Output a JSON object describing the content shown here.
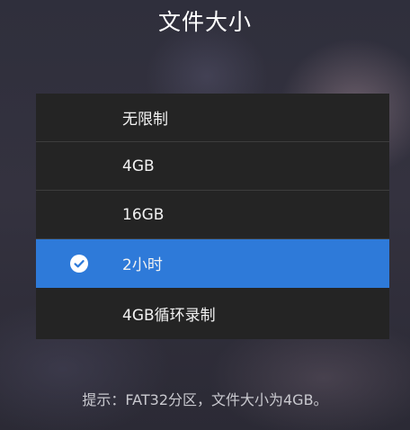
{
  "dialog": {
    "title": "文件大小",
    "options": [
      {
        "label": "无限制",
        "selected": false
      },
      {
        "label": "4GB",
        "selected": false
      },
      {
        "label": "16GB",
        "selected": false
      },
      {
        "label": "2小时",
        "selected": true
      },
      {
        "label": "4GB循环录制",
        "selected": false
      }
    ],
    "hint": "提示：FAT32分区，文件大小为4GB。"
  },
  "colors": {
    "selected_background": "#2e7ad9",
    "list_background": "#242424",
    "text": "#f2f2f2"
  },
  "icons": {
    "selected_marker": "check-circle-icon"
  }
}
